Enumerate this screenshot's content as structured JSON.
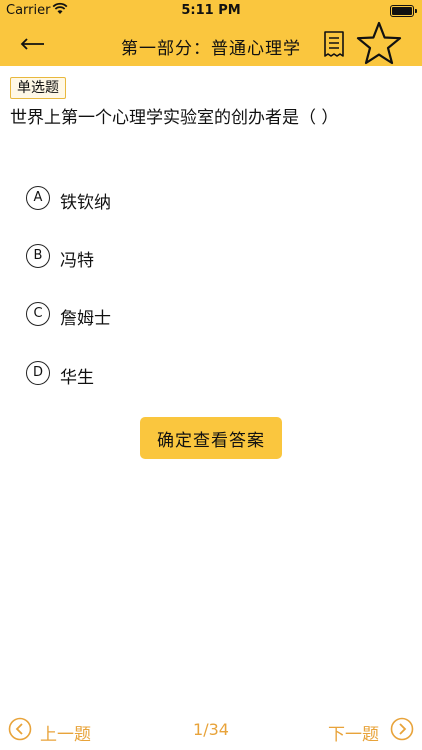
{
  "status": {
    "carrier": "Carrier",
    "time": "5:11 PM"
  },
  "nav": {
    "title": "第一部分：普通心理学"
  },
  "question": {
    "type_tag": "单选题",
    "text": "世界上第一个心理学实验室的创办者是（   ）",
    "options": [
      {
        "letter": "A",
        "text": "铁钦纳"
      },
      {
        "letter": "B",
        "text": "冯特"
      },
      {
        "letter": "C",
        "text": "詹姆士"
      },
      {
        "letter": "D",
        "text": "华生"
      }
    ]
  },
  "confirm_label": "确定查看答案",
  "footer": {
    "prev_label": "上一题",
    "page_indicator": "1/34",
    "next_label": "下一题"
  },
  "colors": {
    "accent": "#FAC63E",
    "footer_text": "#E8A33A"
  },
  "icons": [
    "wifi-icon",
    "battery-icon",
    "back-arrow-icon",
    "document-icon",
    "star-icon",
    "prev-arrow-icon",
    "next-arrow-icon"
  ]
}
